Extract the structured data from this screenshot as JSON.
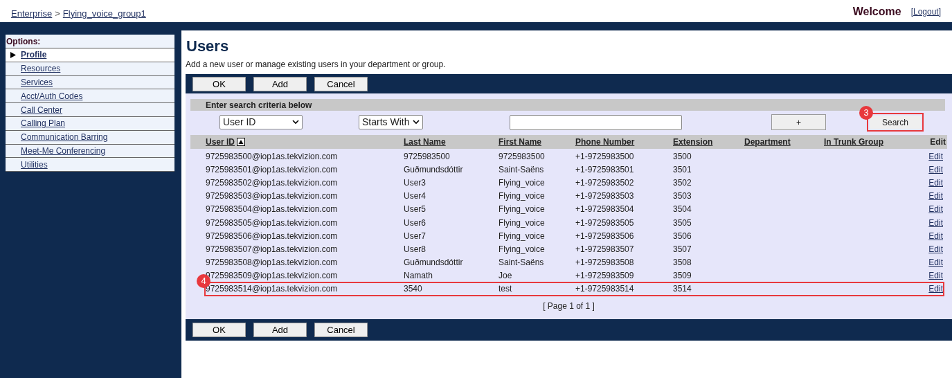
{
  "header": {
    "breadcrumb": [
      {
        "label": "Enterprise"
      },
      {
        "label": "Flying_voice_group1"
      }
    ],
    "separator": ">",
    "welcome": "Welcome",
    "logout": "[Logout]"
  },
  "sidebar": {
    "title": "Options:",
    "items": [
      {
        "label": "Profile",
        "selected": true
      },
      {
        "label": "Resources",
        "selected": false
      },
      {
        "label": "Services",
        "selected": false
      },
      {
        "label": "Acct/Auth Codes",
        "selected": false
      },
      {
        "label": "Call Center",
        "selected": false
      },
      {
        "label": "Calling Plan",
        "selected": false
      },
      {
        "label": "Communication Barring",
        "selected": false
      },
      {
        "label": "Meet-Me Conferencing",
        "selected": false
      },
      {
        "label": "Utilities",
        "selected": false
      }
    ]
  },
  "page": {
    "title": "Users",
    "description": "Add a new user or manage existing users in your department or group.",
    "top_buttons": [
      "OK",
      "Add",
      "Cancel"
    ],
    "bottom_buttons": [
      "OK",
      "Add",
      "Cancel"
    ]
  },
  "search": {
    "heading": "Enter search criteria below",
    "field_select": "User ID",
    "mode_select": "Starts With",
    "plus_button": "+",
    "search_button": {
      "label": "Search",
      "highlighted": true,
      "annotation": "3"
    }
  },
  "table": {
    "columns": [
      {
        "label": "User ID",
        "kind": "sortable",
        "sorted": true
      },
      {
        "label": "Last Name",
        "kind": "sortable",
        "sorted": false
      },
      {
        "label": "First Name",
        "kind": "sortable",
        "sorted": false
      },
      {
        "label": "Phone Number",
        "kind": "sortable",
        "sorted": false
      },
      {
        "label": "Extension",
        "kind": "sortable",
        "sorted": false
      },
      {
        "label": "Department",
        "kind": "sortable",
        "sorted": false
      },
      {
        "label": "In Trunk Group",
        "kind": "sortable",
        "sorted": false
      },
      {
        "label": "Edit",
        "kind": "plain"
      }
    ],
    "rows": [
      {
        "cells": [
          "9725983500@iop1as.tekvizion.com",
          "9725983500",
          "9725983500",
          "+1-9725983500",
          "3500"
        ],
        "edit": "Edit",
        "highlighted": false
      },
      {
        "cells": [
          "9725983501@iop1as.tekvizion.com",
          "Guðmundsdóttir",
          "Saint-Saëns",
          "+1-9725983501",
          "3501"
        ],
        "edit": "Edit",
        "highlighted": false
      },
      {
        "cells": [
          "9725983502@iop1as.tekvizion.com",
          "User3",
          "Flying_voice",
          "+1-9725983502",
          "3502"
        ],
        "edit": "Edit",
        "highlighted": false
      },
      {
        "cells": [
          "9725983503@iop1as.tekvizion.com",
          "User4",
          "Flying_voice",
          "+1-9725983503",
          "3503"
        ],
        "edit": "Edit",
        "highlighted": false
      },
      {
        "cells": [
          "9725983504@iop1as.tekvizion.com",
          "User5",
          "Flying_voice",
          "+1-9725983504",
          "3504"
        ],
        "edit": "Edit",
        "highlighted": false
      },
      {
        "cells": [
          "9725983505@iop1as.tekvizion.com",
          "User6",
          "Flying_voice",
          "+1-9725983505",
          "3505"
        ],
        "edit": "Edit",
        "highlighted": false
      },
      {
        "cells": [
          "9725983506@iop1as.tekvizion.com",
          "User7",
          "Flying_voice",
          "+1-9725983506",
          "3506"
        ],
        "edit": "Edit",
        "highlighted": false
      },
      {
        "cells": [
          "9725983507@iop1as.tekvizion.com",
          "User8",
          "Flying_voice",
          "+1-9725983507",
          "3507"
        ],
        "edit": "Edit",
        "highlighted": false
      },
      {
        "cells": [
          "9725983508@iop1as.tekvizion.com",
          "Guðmundsdóttir",
          "Saint-Saëns",
          "+1-9725983508",
          "3508"
        ],
        "edit": "Edit",
        "highlighted": false
      },
      {
        "cells": [
          "9725983509@iop1as.tekvizion.com",
          "Namath",
          "Joe",
          "+1-9725983509",
          "3509"
        ],
        "edit": "Edit",
        "highlighted": false
      },
      {
        "cells": [
          "9725983514@iop1as.tekvizion.com",
          "3540",
          "test",
          "+1-9725983514",
          "3514"
        ],
        "edit": "Edit",
        "highlighted": true,
        "annotation": "4"
      }
    ],
    "page_info": "[ Page 1 of 1 ]"
  }
}
